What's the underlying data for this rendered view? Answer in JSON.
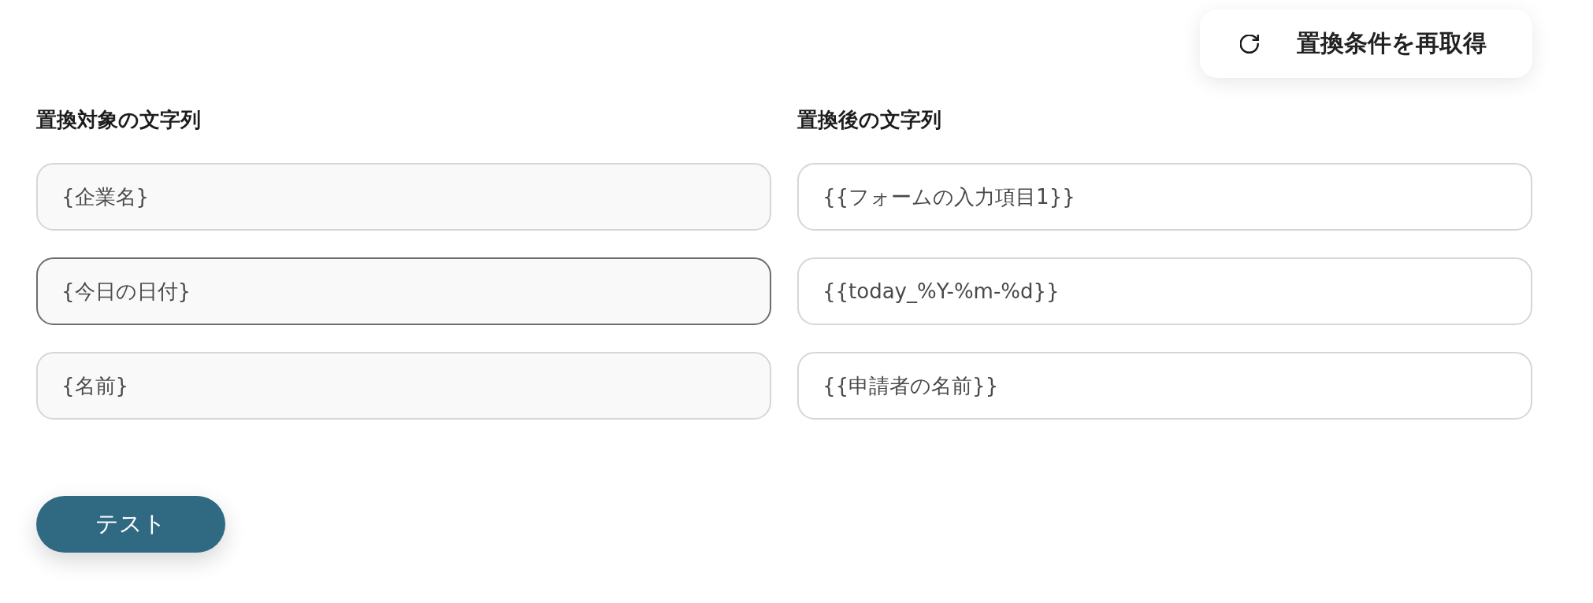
{
  "refresh_button": {
    "label": "置換条件を再取得"
  },
  "columns": [
    {
      "heading": "置換対象の文字列",
      "kind": "source",
      "fields": [
        {
          "value": "{企業名}",
          "focused": false
        },
        {
          "value": "{今日の日付}",
          "focused": true
        },
        {
          "value": "{名前}",
          "focused": false
        }
      ]
    },
    {
      "heading": "置換後の文字列",
      "kind": "target",
      "fields": [
        {
          "value": "{{フォームの入力項目1}}",
          "focused": false
        },
        {
          "value": "{{today_%Y-%m-%d}}",
          "focused": false
        },
        {
          "value": "{{申請者の名前}}",
          "focused": false
        }
      ]
    }
  ],
  "test_button": {
    "label": "テスト"
  }
}
